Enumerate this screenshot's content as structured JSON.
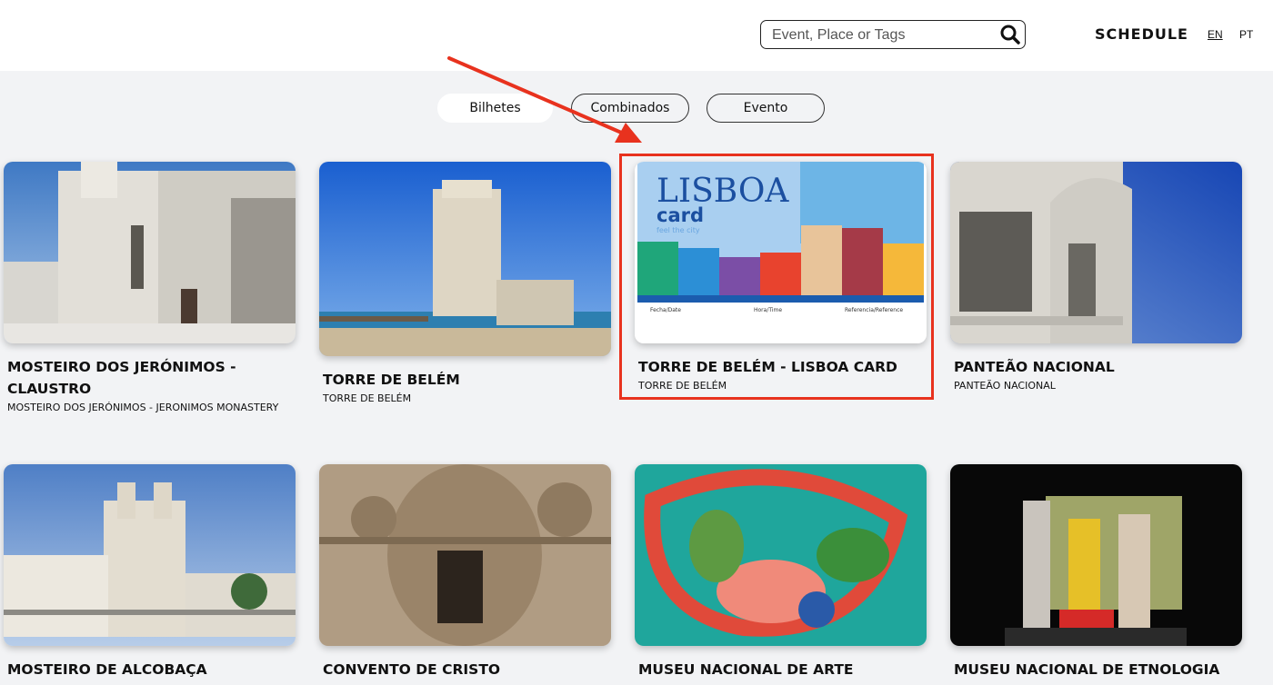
{
  "header": {
    "search": {
      "placeholder": "Event, Place or Tags",
      "value": ""
    },
    "schedule_label": "SCHEDULE",
    "lang_en": "EN",
    "lang_pt": "PT"
  },
  "tabs": [
    {
      "label": "Bilhetes",
      "active": true
    },
    {
      "label": "Combinados",
      "active": false
    },
    {
      "label": "Evento",
      "active": false
    }
  ],
  "cards": [
    {
      "title": "MOSTEIRO DOS JERÓNIMOS - CLAUSTRO",
      "subtitle": "MOSTEIRO DOS JERÓNIMOS - JERONIMOS MONASTERY"
    },
    {
      "title": "TORRE DE BELÉM",
      "subtitle": "TORRE DE BELÉM"
    },
    {
      "title": "TORRE DE BELÉM - LISBOA CARD",
      "subtitle": "TORRE DE BELÉM"
    },
    {
      "title": "PANTEÃO NACIONAL",
      "subtitle": "PANTEÃO NACIONAL"
    },
    {
      "title": "MOSTEIRO DE ALCOBAÇA",
      "subtitle": ""
    },
    {
      "title": "CONVENTO DE CRISTO",
      "subtitle": ""
    },
    {
      "title": "MUSEU NACIONAL DE ARTE",
      "subtitle": ""
    },
    {
      "title": "MUSEU NACIONAL DE ETNOLOGIA",
      "subtitle": ""
    }
  ],
  "lisboa_card": {
    "logo": "LISBOA",
    "card_word": "card",
    "tagline": "feel the city",
    "fields": [
      "Fecha/Date",
      "Hora/Time",
      "Referencia/Reference"
    ]
  },
  "colors": {
    "highlight": "#e8321e",
    "header_bg": "#ffffff",
    "page_bg": "#f2f3f5"
  }
}
